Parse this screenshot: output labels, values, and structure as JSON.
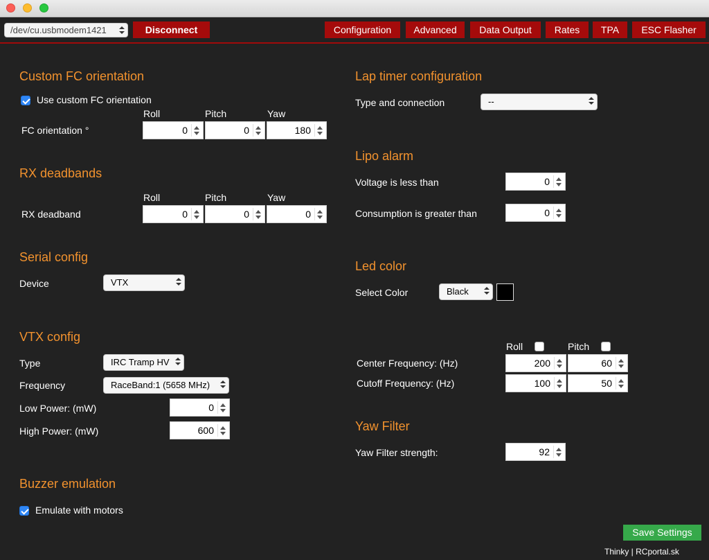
{
  "header": {
    "port": "/dev/cu.usbmodem1421",
    "disconnect_label": "Disconnect",
    "tabs": [
      "Configuration",
      "Advanced",
      "Data Output",
      "Rates",
      "TPA",
      "ESC Flasher"
    ]
  },
  "fc_orientation": {
    "title": "Custom FC orientation",
    "checkbox_label": "Use custom FC orientation",
    "checked": true,
    "row_label": "FC orientation °",
    "cols": [
      "Roll",
      "Pitch",
      "Yaw"
    ],
    "values": [
      "0",
      "0",
      "180"
    ]
  },
  "rx_deadbands": {
    "title": "RX deadbands",
    "row_label": "RX deadband",
    "cols": [
      "Roll",
      "Pitch",
      "Yaw"
    ],
    "values": [
      "0",
      "0",
      "0"
    ]
  },
  "serial": {
    "title": "Serial config",
    "device_label": "Device",
    "device_value": "VTX"
  },
  "vtx": {
    "title": "VTX config",
    "type_label": "Type",
    "type_value": "IRC Tramp HV",
    "frequency_label": "Frequency",
    "frequency_value": "RaceBand:1 (5658 MHz)",
    "low_power_label": "Low Power: (mW)",
    "low_power_value": "0",
    "high_power_label": "High Power: (mW)",
    "high_power_value": "600"
  },
  "buzzer": {
    "title": "Buzzer emulation",
    "checkbox_label": "Emulate with motors",
    "checked": true
  },
  "lap_timer": {
    "title": "Lap timer configuration",
    "type_label": "Type and connection",
    "type_value": "--"
  },
  "lipo": {
    "title": "Lipo alarm",
    "voltage_label": "Voltage is less than",
    "voltage_value": "0",
    "consumption_label": "Consumption is greater than",
    "consumption_value": "0"
  },
  "led": {
    "title": "Led color",
    "select_label": "Select Color",
    "color_value": "Black",
    "swatch_color": "#000000"
  },
  "filter": {
    "roll_label": "Roll",
    "pitch_label": "Pitch",
    "center_label": "Center Frequency: (Hz)",
    "cutoff_label": "Cutoff Frequency: (Hz)",
    "center_roll": "200",
    "center_pitch": "60",
    "cutoff_roll": "100",
    "cutoff_pitch": "50"
  },
  "yaw_filter": {
    "title": "Yaw Filter",
    "strength_label": "Yaw Filter strength:",
    "strength_value": "92"
  },
  "save_label": "Save Settings",
  "footer": "Thinky | RCportal.sk",
  "colors": {
    "heading": "#f2922e",
    "accent_red": "#a50b0b",
    "save_green": "#36a94a",
    "background": "#222222"
  }
}
